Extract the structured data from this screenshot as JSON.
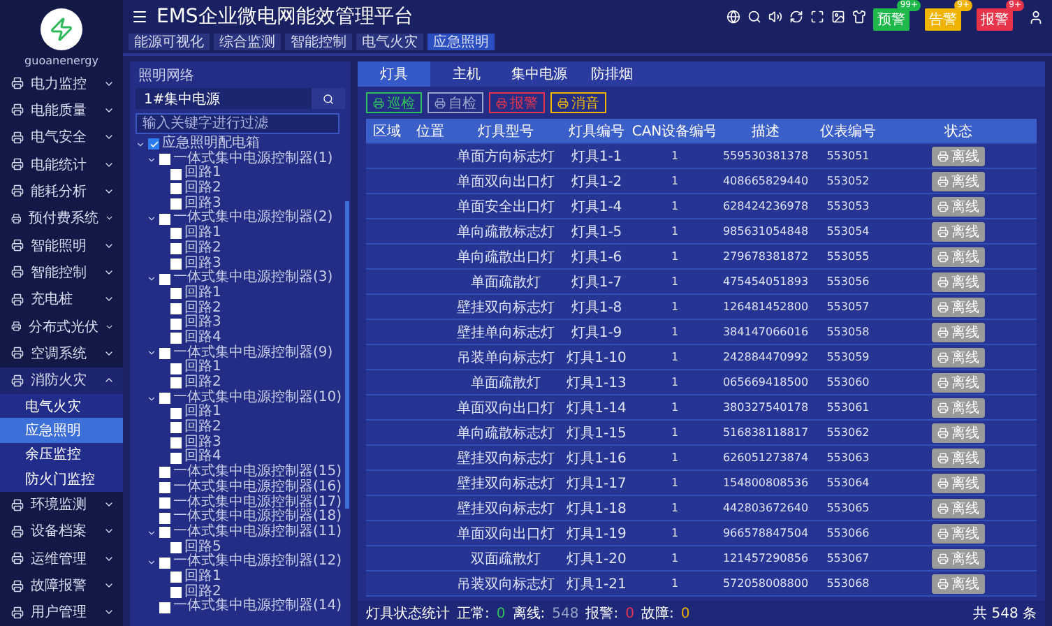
{
  "brand": {
    "name": "guoanenergy"
  },
  "header": {
    "title": "EMS企业微电网能效管理平台",
    "badges": [
      {
        "label": "预警",
        "count": "99+",
        "color": "#1fb84a"
      },
      {
        "label": "告警",
        "count": "9+",
        "color": "#f0b400"
      },
      {
        "label": "报警",
        "count": "9+",
        "color": "#e8344a"
      }
    ]
  },
  "breadcrumbs": [
    {
      "label": "能源可视化",
      "selected": false
    },
    {
      "label": "综合监测",
      "selected": false
    },
    {
      "label": "智能控制",
      "selected": false
    },
    {
      "label": "电气火灾",
      "selected": false
    },
    {
      "label": "应急照明",
      "selected": true
    }
  ],
  "sidebar": {
    "items": [
      {
        "label": "电力监控",
        "expanded": false
      },
      {
        "label": "电能质量",
        "expanded": false
      },
      {
        "label": "电气安全",
        "expanded": false
      },
      {
        "label": "电能统计",
        "expanded": false
      },
      {
        "label": "能耗分析",
        "expanded": false
      },
      {
        "label": "预付费系统",
        "expanded": false
      },
      {
        "label": "智能照明",
        "expanded": false
      },
      {
        "label": "智能控制",
        "expanded": false
      },
      {
        "label": "充电桩",
        "expanded": false
      },
      {
        "label": "分布式光伏",
        "expanded": false
      },
      {
        "label": "空调系统",
        "expanded": false
      },
      {
        "label": "消防火灾",
        "expanded": true,
        "children": [
          {
            "label": "电气火灾",
            "selected": false
          },
          {
            "label": "应急照明",
            "selected": true
          },
          {
            "label": "余压监控",
            "selected": false
          },
          {
            "label": "防火门监控",
            "selected": false
          }
        ]
      },
      {
        "label": "环境监测",
        "expanded": false
      },
      {
        "label": "设备档案",
        "expanded": false
      },
      {
        "label": "运维管理",
        "expanded": false
      },
      {
        "label": "故障报警",
        "expanded": false
      },
      {
        "label": "用户管理",
        "expanded": false
      }
    ]
  },
  "tree_panel": {
    "title": "照明网络",
    "select": "1#集中电源",
    "search": {
      "placeholder": "输入关键字进行过滤"
    },
    "tree": [
      {
        "label": "应急照明配电箱",
        "checked": true,
        "children": [
          {
            "label": "一体式集中电源控制器(1)",
            "checked": false,
            "children": [
              {
                "label": "回路1",
                "checked": false
              },
              {
                "label": "回路2",
                "checked": false
              },
              {
                "label": "回路3",
                "checked": false
              }
            ]
          },
          {
            "label": "一体式集中电源控制器(2)",
            "checked": false,
            "children": [
              {
                "label": "回路1",
                "checked": false
              },
              {
                "label": "回路2",
                "checked": false
              },
              {
                "label": "回路3",
                "checked": false
              }
            ]
          },
          {
            "label": "一体式集中电源控制器(3)",
            "checked": false,
            "children": [
              {
                "label": "回路1",
                "checked": false
              },
              {
                "label": "回路2",
                "checked": false
              },
              {
                "label": "回路3",
                "checked": false
              },
              {
                "label": "回路4",
                "checked": false
              }
            ]
          },
          {
            "label": "一体式集中电源控制器(9)",
            "checked": false,
            "children": [
              {
                "label": "回路1",
                "checked": false
              },
              {
                "label": "回路2",
                "checked": false
              }
            ]
          },
          {
            "label": "一体式集中电源控制器(10)",
            "checked": false,
            "children": [
              {
                "label": "回路1",
                "checked": false
              },
              {
                "label": "回路2",
                "checked": false
              },
              {
                "label": "回路3",
                "checked": false
              },
              {
                "label": "回路4",
                "checked": false
              }
            ]
          },
          {
            "label": "一体式集中电源控制器(15)",
            "checked": false
          },
          {
            "label": "一体式集中电源控制器(16)",
            "checked": false
          },
          {
            "label": "一体式集中电源控制器(17)",
            "checked": false
          },
          {
            "label": "一体式集中电源控制器(18)",
            "checked": false
          },
          {
            "label": "一体式集中电源控制器(11)",
            "checked": false,
            "children": [
              {
                "label": "回路5",
                "checked": false
              }
            ]
          },
          {
            "label": "一体式集中电源控制器(12)",
            "checked": false,
            "children": [
              {
                "label": "回路1",
                "checked": false
              },
              {
                "label": "回路2",
                "checked": false
              }
            ]
          },
          {
            "label": "一体式集中电源控制器(14)",
            "checked": false
          }
        ]
      }
    ]
  },
  "tabs": [
    {
      "label": "灯具",
      "selected": true
    },
    {
      "label": "主机",
      "selected": false
    },
    {
      "label": "集中电源",
      "selected": false
    },
    {
      "label": "防排烟",
      "selected": false
    }
  ],
  "actions": [
    {
      "label": "巡检",
      "color": "#2fc25b"
    },
    {
      "label": "自检",
      "color": "#9aa3c8"
    },
    {
      "label": "报警",
      "color": "#e8344a"
    },
    {
      "label": "消音",
      "color": "#f0b400"
    }
  ],
  "table": {
    "columns": [
      "区域",
      "位置",
      "灯具型号",
      "灯具编号",
      "CAN设备编号",
      "描述",
      "仪表编号",
      "状态"
    ],
    "rows": [
      {
        "model": "单面方向标志灯",
        "number": "灯具1-1",
        "can": "1",
        "desc": "559530381378",
        "meter": "553051",
        "status": "离线"
      },
      {
        "model": "单面双向出口灯",
        "number": "灯具1-2",
        "can": "1",
        "desc": "408665829440",
        "meter": "553052",
        "status": "离线"
      },
      {
        "model": "单面安全出口灯",
        "number": "灯具1-4",
        "can": "1",
        "desc": "628424236978",
        "meter": "553053",
        "status": "离线"
      },
      {
        "model": "单向疏散标志灯",
        "number": "灯具1-5",
        "can": "1",
        "desc": "985631054848",
        "meter": "553054",
        "status": "离线"
      },
      {
        "model": "单向疏散出口灯",
        "number": "灯具1-6",
        "can": "1",
        "desc": "279678381872",
        "meter": "553055",
        "status": "离线"
      },
      {
        "model": "单面疏散灯",
        "number": "灯具1-7",
        "can": "1",
        "desc": "475454051893",
        "meter": "553056",
        "status": "离线"
      },
      {
        "model": "壁挂双向标志灯",
        "number": "灯具1-8",
        "can": "1",
        "desc": "126481452800",
        "meter": "553057",
        "status": "离线"
      },
      {
        "model": "壁挂单向标志灯",
        "number": "灯具1-9",
        "can": "1",
        "desc": "384147066016",
        "meter": "553058",
        "status": "离线"
      },
      {
        "model": "吊装单向标志灯",
        "number": "灯具1-10",
        "can": "1",
        "desc": "242884470992",
        "meter": "553059",
        "status": "离线"
      },
      {
        "model": "单面疏散灯",
        "number": "灯具1-13",
        "can": "1",
        "desc": "065669418500",
        "meter": "553060",
        "status": "离线"
      },
      {
        "model": "单面双向出口灯",
        "number": "灯具1-14",
        "can": "1",
        "desc": "380327540178",
        "meter": "553061",
        "status": "离线"
      },
      {
        "model": "单向疏散标志灯",
        "number": "灯具1-15",
        "can": "1",
        "desc": "516838118817",
        "meter": "553062",
        "status": "离线"
      },
      {
        "model": "壁挂双向标志灯",
        "number": "灯具1-16",
        "can": "1",
        "desc": "626051273874",
        "meter": "553063",
        "status": "离线"
      },
      {
        "model": "壁挂双向标志灯",
        "number": "灯具1-17",
        "can": "1",
        "desc": "154800808536",
        "meter": "553064",
        "status": "离线"
      },
      {
        "model": "壁挂双向标志灯",
        "number": "灯具1-18",
        "can": "1",
        "desc": "442803672640",
        "meter": "553065",
        "status": "离线"
      },
      {
        "model": "单面双向出口灯",
        "number": "灯具1-19",
        "can": "1",
        "desc": "966578847504",
        "meter": "553066",
        "status": "离线"
      },
      {
        "model": "双面疏散灯",
        "number": "灯具1-20",
        "can": "1",
        "desc": "121457290856",
        "meter": "553067",
        "status": "离线"
      },
      {
        "model": "吊装双向标志灯",
        "number": "灯具1-21",
        "can": "1",
        "desc": "572058008800",
        "meter": "553068",
        "status": "离线"
      }
    ]
  },
  "footer": {
    "title": "灯具状态统计",
    "stats": [
      {
        "label": "正常:",
        "value": "0",
        "color": "#2fc25b"
      },
      {
        "label": "离线:",
        "value": "548",
        "color": "#9aa3c8"
      },
      {
        "label": "报警:",
        "value": "0",
        "color": "#e8344a"
      },
      {
        "label": "故障:",
        "value": "0",
        "color": "#f0b400"
      }
    ],
    "total": "共 548 条"
  }
}
